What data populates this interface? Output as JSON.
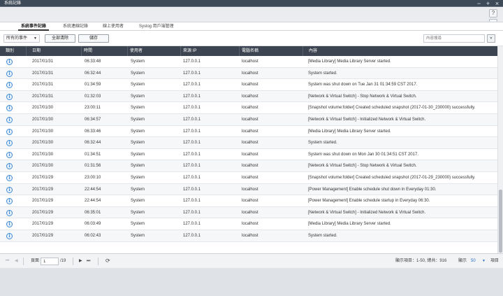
{
  "window": {
    "title": "系統記錄",
    "controls": [
      "−",
      "+",
      "×"
    ],
    "help_label": "?",
    "info_label": "i"
  },
  "tabs": [
    {
      "label": "系統事件記錄",
      "active": true
    },
    {
      "label": "系統連線記錄",
      "active": false
    },
    {
      "label": "線上使用者",
      "active": false
    },
    {
      "label": "Syslog 用戶端管理",
      "active": false
    }
  ],
  "filter": {
    "select_value": "所有的事件",
    "clear_all_label": "全部清除",
    "save_label": "儲存",
    "search_placeholder": "內容搜尋"
  },
  "columns": [
    "類別",
    "日期",
    "時間",
    "使用者",
    "來源 IP",
    "電腦名稱",
    "內容"
  ],
  "rows": [
    {
      "date": "2017/01/31",
      "time": "06:33:48",
      "user": "System",
      "ip": "127.0.0.1",
      "host": "localhost",
      "content": "[Media Library] Media Library Server started."
    },
    {
      "date": "2017/01/31",
      "time": "06:32:44",
      "user": "System",
      "ip": "127.0.0.1",
      "host": "localhost",
      "content": "System started."
    },
    {
      "date": "2017/01/31",
      "time": "01:34:59",
      "user": "System",
      "ip": "127.0.0.1",
      "host": "localhost",
      "content": "System was shut down on Tue Jan 31 01:34:59 CST 2017."
    },
    {
      "date": "2017/01/31",
      "time": "01:32:03",
      "user": "System",
      "ip": "127.0.0.1",
      "host": "localhost",
      "content": "[Network & Virtual Switch] - Stop Network & Virtual Switch."
    },
    {
      "date": "2017/01/30",
      "time": "23:00:11",
      "user": "System",
      "ip": "127.0.0.1",
      "host": "localhost",
      "content": "[Snapshot volume:folder] Created scheduled snapshot (2017-01-30_230000) successfully."
    },
    {
      "date": "2017/01/30",
      "time": "06:34:57",
      "user": "System",
      "ip": "127.0.0.1",
      "host": "localhost",
      "content": "[Network & Virtual Switch] - Initialized Network & Virtual Switch."
    },
    {
      "date": "2017/01/30",
      "time": "06:33:46",
      "user": "System",
      "ip": "127.0.0.1",
      "host": "localhost",
      "content": "[Media Library] Media Library Server started."
    },
    {
      "date": "2017/01/30",
      "time": "06:32:44",
      "user": "System",
      "ip": "127.0.0.1",
      "host": "localhost",
      "content": "System started."
    },
    {
      "date": "2017/01/30",
      "time": "01:34:51",
      "user": "System",
      "ip": "127.0.0.1",
      "host": "localhost",
      "content": "System was shut down on Mon Jan 30 01:34:51 CST 2017."
    },
    {
      "date": "2017/01/30",
      "time": "01:31:56",
      "user": "System",
      "ip": "127.0.0.1",
      "host": "localhost",
      "content": "[Network & Virtual Switch] - Stop Network & Virtual Switch."
    },
    {
      "date": "2017/01/29",
      "time": "23:00:10",
      "user": "System",
      "ip": "127.0.0.1",
      "host": "localhost",
      "content": "[Snapshot volume:folder] Created scheduled snapshot (2017-01-29_230000) successfully."
    },
    {
      "date": "2017/01/29",
      "time": "22:44:54",
      "user": "System",
      "ip": "127.0.0.1",
      "host": "localhost",
      "content": "[Power Management] Enable schedule shut down in Everyday 01:30."
    },
    {
      "date": "2017/01/29",
      "time": "22:44:54",
      "user": "System",
      "ip": "127.0.0.1",
      "host": "localhost",
      "content": "[Power Management] Enable schedule startup in Everyday 06:30."
    },
    {
      "date": "2017/01/29",
      "time": "06:35:01",
      "user": "System",
      "ip": "127.0.0.1",
      "host": "localhost",
      "content": "[Network & Virtual Switch] - Initialized Network & Virtual Switch."
    },
    {
      "date": "2017/01/29",
      "time": "06:03:49",
      "user": "System",
      "ip": "127.0.0.1",
      "host": "localhost",
      "content": "[Media Library] Media Library Server started."
    },
    {
      "date": "2017/01/29",
      "time": "06:02:43",
      "user": "System",
      "ip": "127.0.0.1",
      "host": "localhost",
      "content": "System started."
    }
  ],
  "row_icon": "info-icon",
  "pager": {
    "first": "⏮",
    "prev": "◀",
    "page_label": "頁面",
    "page_value": "1",
    "total_pages": "/19",
    "next": "▶",
    "last": "⏭",
    "refresh": "⟳",
    "summary": "顯示項目：1-50, 總共：916",
    "show_label": "顯示",
    "page_size": "50",
    "items_label": "項目"
  },
  "colors": {
    "header_bg": "#3b4450",
    "info_icon": "#3d89d8",
    "page_size": "#2c6fc4"
  }
}
